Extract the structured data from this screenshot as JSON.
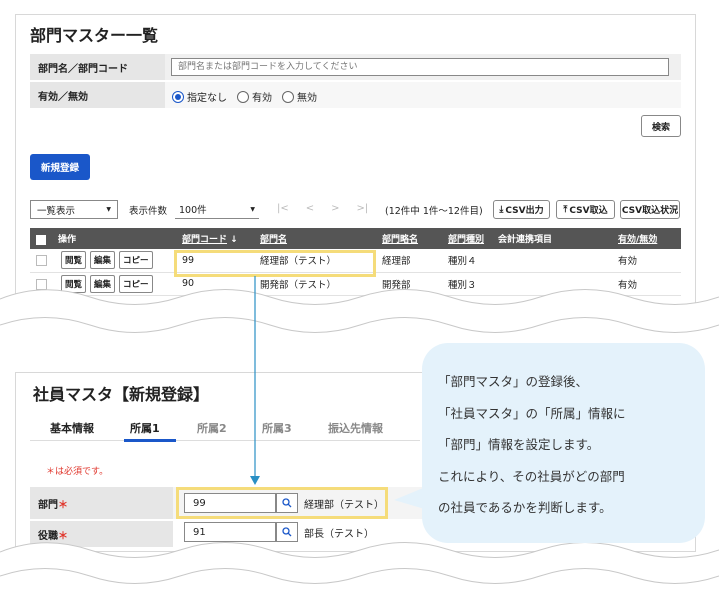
{
  "dept_list": {
    "title": "部門マスター一覧",
    "name_code_label": "部門名／部門コード",
    "search_placeholder": "部門名または部門コードを入力してください",
    "validity_label": "有効／無効",
    "radio_options": [
      "指定なし",
      "有効",
      "無効"
    ],
    "radio_selected": 0,
    "search_button": "検索",
    "new_button": "新規登録",
    "view_select": "一覧表示",
    "display_count_label": "表示件数",
    "display_count_value": "100件",
    "pager": {
      "first": "|<",
      "prev": "<",
      "next": ">",
      "last": ">|"
    },
    "count_text": "(12件中 1件〜12件目)",
    "csv_export": "CSV出力",
    "csv_import": "CSV取込",
    "csv_status": "CSV取込状況",
    "columns": {
      "op": "操作",
      "code": "部門コード",
      "name": "部門名",
      "short": "部門略名",
      "kind": "部門種別",
      "acct": "会計連携項目",
      "valid": "有効/無効"
    },
    "row_buttons": [
      "閲覧",
      "編集",
      "コピー"
    ],
    "rows": [
      {
        "code": "99",
        "name": "経理部（テスト）",
        "short": "経理部",
        "kind": "種別４",
        "acct": "",
        "valid": "有効"
      },
      {
        "code": "90",
        "name": "開発部（テスト）",
        "short": "開発部",
        "kind": "種別３",
        "acct": "",
        "valid": "有効"
      }
    ]
  },
  "emp": {
    "title": "社員マスタ【新規登録】",
    "tabs": [
      "基本情報",
      "所属1",
      "所属2",
      "所属3",
      "振込先情報"
    ],
    "active_tab": 1,
    "required_note": "＊は必須です。",
    "dept_label": "部門",
    "dept_value": "99",
    "dept_name": "経理部（テスト）",
    "position_label": "役職",
    "position_value": "91",
    "position_name": "部長（テスト）",
    "required_mark": "＊"
  },
  "callout": {
    "line1": "「部門マスタ」の登録後、",
    "line2": "「社員マスタ」の「所属」情報に",
    "line3": "「部門」情報を設定します。",
    "line4": "これにより、その社員がどの部門",
    "line5": "の社員であるかを判断します。"
  },
  "colors": {
    "primary": "#1a57c9",
    "highlight": "#f5dc7a",
    "callout_bg": "#e4f2fb",
    "arrow": "#2a8fc4"
  }
}
